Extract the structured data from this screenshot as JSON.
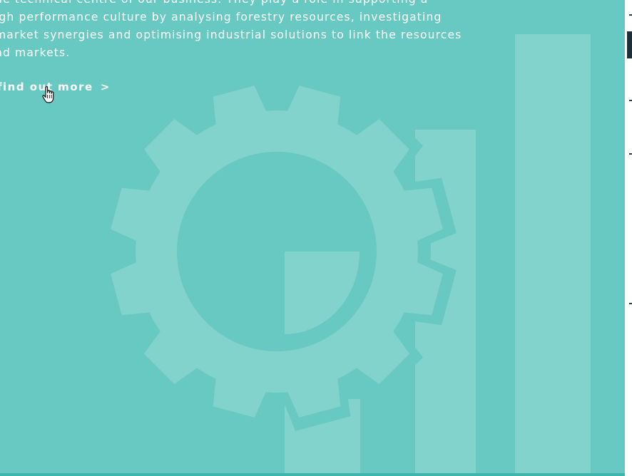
{
  "colors": {
    "background": "#67c9c2",
    "graphic_light": "#82d3cc",
    "text": "#ffffff",
    "bottom_border": "#3fb6ad"
  },
  "intro": {
    "lines": [
      "he technical centre of our business. They play a role in supporting a",
      "igh performance culture by analysing forestry resources, investigating",
      "market synergies and optimising industrial solutions to link the resources",
      "nd markets."
    ]
  },
  "cta": {
    "label": "find out more",
    "chevron": ">"
  },
  "icons": {
    "cursor": "hand-pointer-icon",
    "graphic": "gear-chart-illustration"
  }
}
